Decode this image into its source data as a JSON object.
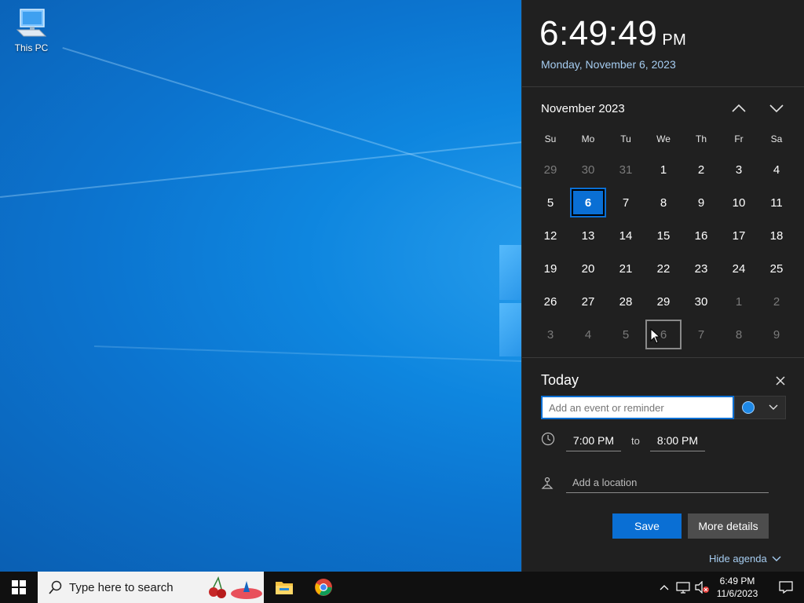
{
  "desktop": {
    "icons": [
      {
        "label": "This PC",
        "icon": "this-pc-icon"
      }
    ]
  },
  "flyout": {
    "clock": {
      "time": "6:49:49",
      "ampm": "PM",
      "date": "Monday, November 6, 2023"
    },
    "calendar": {
      "month_label": "November 2023",
      "weekdays": [
        "Su",
        "Mo",
        "Tu",
        "We",
        "Th",
        "Fr",
        "Sa"
      ],
      "weeks": [
        [
          {
            "d": "29",
            "o": true
          },
          {
            "d": "30",
            "o": true
          },
          {
            "d": "31",
            "o": true
          },
          {
            "d": "1"
          },
          {
            "d": "2"
          },
          {
            "d": "3"
          },
          {
            "d": "4"
          }
        ],
        [
          {
            "d": "5"
          },
          {
            "d": "6",
            "today": true
          },
          {
            "d": "7"
          },
          {
            "d": "8"
          },
          {
            "d": "9"
          },
          {
            "d": "10"
          },
          {
            "d": "11"
          }
        ],
        [
          {
            "d": "12"
          },
          {
            "d": "13"
          },
          {
            "d": "14"
          },
          {
            "d": "15"
          },
          {
            "d": "16"
          },
          {
            "d": "17"
          },
          {
            "d": "18"
          }
        ],
        [
          {
            "d": "19"
          },
          {
            "d": "20"
          },
          {
            "d": "21"
          },
          {
            "d": "22"
          },
          {
            "d": "23"
          },
          {
            "d": "24"
          },
          {
            "d": "25"
          }
        ],
        [
          {
            "d": "26"
          },
          {
            "d": "27"
          },
          {
            "d": "28"
          },
          {
            "d": "29"
          },
          {
            "d": "30"
          },
          {
            "d": "1",
            "o": true
          },
          {
            "d": "2",
            "o": true
          }
        ],
        [
          {
            "d": "3",
            "o": true
          },
          {
            "d": "4",
            "o": true
          },
          {
            "d": "5",
            "o": true
          },
          {
            "d": "6",
            "o": true,
            "hover": true
          },
          {
            "d": "7",
            "o": true
          },
          {
            "d": "8",
            "o": true
          },
          {
            "d": "9",
            "o": true
          }
        ]
      ]
    },
    "agenda": {
      "title": "Today",
      "event_placeholder": "Add an event or reminder",
      "start_time": "7:00 PM",
      "to_label": "to",
      "end_time": "8:00 PM",
      "location_placeholder": "Add a location",
      "save_label": "Save",
      "more_details_label": "More details",
      "hide_agenda_label": "Hide agenda"
    },
    "colors": {
      "accent": "#0a6fd4",
      "link": "#a6cdf1",
      "panel_bg": "#202020"
    }
  },
  "taskbar": {
    "search_placeholder": "Type here to search",
    "apps": [
      "file-explorer-icon",
      "chrome-icon"
    ],
    "tray": {
      "time": "6:49 PM",
      "date": "11/6/2023"
    }
  }
}
